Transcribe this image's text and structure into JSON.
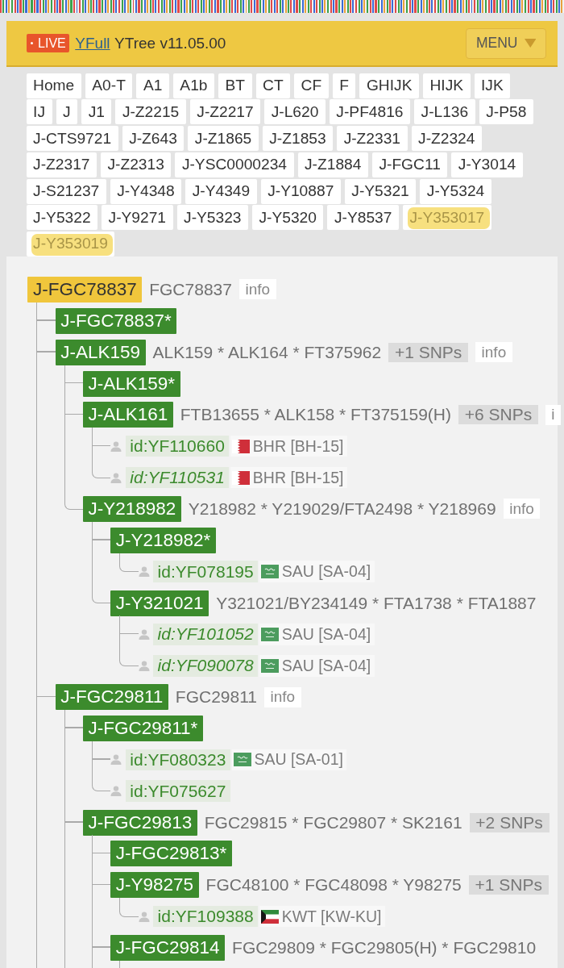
{
  "header": {
    "live_badge": "LIVE",
    "site_link": "YFull",
    "title": "YTree v11.05.00",
    "menu_button": "MENU"
  },
  "breadcrumbs": [
    {
      "label": "Home",
      "highlighted": false
    },
    {
      "label": "A0-T",
      "highlighted": false
    },
    {
      "label": "A1",
      "highlighted": false
    },
    {
      "label": "A1b",
      "highlighted": false
    },
    {
      "label": "BT",
      "highlighted": false
    },
    {
      "label": "CT",
      "highlighted": false
    },
    {
      "label": "CF",
      "highlighted": false
    },
    {
      "label": "F",
      "highlighted": false
    },
    {
      "label": "GHIJK",
      "highlighted": false
    },
    {
      "label": "HIJK",
      "highlighted": false
    },
    {
      "label": "IJK",
      "highlighted": false
    },
    {
      "label": "IJ",
      "highlighted": false
    },
    {
      "label": "J",
      "highlighted": false
    },
    {
      "label": "J1",
      "highlighted": false
    },
    {
      "label": "J-Z2215",
      "highlighted": false
    },
    {
      "label": "J-Z2217",
      "highlighted": false
    },
    {
      "label": "J-L620",
      "highlighted": false
    },
    {
      "label": "J-PF4816",
      "highlighted": false
    },
    {
      "label": "J-L136",
      "highlighted": false
    },
    {
      "label": "J-P58",
      "highlighted": false
    },
    {
      "label": "J-CTS9721",
      "highlighted": false
    },
    {
      "label": "J-Z643",
      "highlighted": false
    },
    {
      "label": "J-Z1865",
      "highlighted": false
    },
    {
      "label": "J-Z1853",
      "highlighted": false
    },
    {
      "label": "J-Z2331",
      "highlighted": false
    },
    {
      "label": "J-Z2324",
      "highlighted": false
    },
    {
      "label": "J-Z2317",
      "highlighted": false
    },
    {
      "label": "J-Z2313",
      "highlighted": false
    },
    {
      "label": "J-YSC0000234",
      "highlighted": false
    },
    {
      "label": "J-Z1884",
      "highlighted": false
    },
    {
      "label": "J-FGC11",
      "highlighted": false
    },
    {
      "label": "J-Y3014",
      "highlighted": false
    },
    {
      "label": "J-S21237",
      "highlighted": false
    },
    {
      "label": "J-Y4348",
      "highlighted": false
    },
    {
      "label": "J-Y4349",
      "highlighted": false
    },
    {
      "label": "J-Y10887",
      "highlighted": false
    },
    {
      "label": "J-Y5321",
      "highlighted": false
    },
    {
      "label": "J-Y5324",
      "highlighted": false
    },
    {
      "label": "J-Y5322",
      "highlighted": false
    },
    {
      "label": "J-Y9271",
      "highlighted": false
    },
    {
      "label": "J-Y5323",
      "highlighted": false
    },
    {
      "label": "J-Y5320",
      "highlighted": false
    },
    {
      "label": "J-Y8537",
      "highlighted": false
    },
    {
      "label": "J-Y353017",
      "highlighted": true
    },
    {
      "label": "J-Y353019",
      "highlighted": true
    }
  ],
  "tree": {
    "kind": "clade",
    "label": "J-FGC78837",
    "current": true,
    "snps": "FGC78837",
    "info": "info",
    "continues_below": true,
    "children": [
      {
        "kind": "clade",
        "label": "J-FGC78837*",
        "current": false
      },
      {
        "kind": "clade",
        "label": "J-ALK159",
        "current": false,
        "snps": "ALK159 * ALK164 * FT375962",
        "more_snps": "+1 SNPs",
        "info": "info",
        "continues_below": false,
        "children": [
          {
            "kind": "clade",
            "label": "J-ALK159*",
            "current": false
          },
          {
            "kind": "clade",
            "label": "J-ALK161",
            "current": false,
            "snps": "FTB13655 * ALK158 * FT375159(H)",
            "more_snps": "+6 SNPs",
            "info": "i",
            "continues_below": false,
            "children": [
              {
                "kind": "sample",
                "id": "id:YF110660",
                "italic": false,
                "flag": {
                  "kind": "bahrain"
                },
                "country": "BHR [BH-15]"
              },
              {
                "kind": "sample",
                "id": "id:YF110531",
                "italic": true,
                "flag": {
                  "kind": "bahrain"
                },
                "country": "BHR [BH-15]"
              }
            ]
          },
          {
            "kind": "clade",
            "label": "J-Y218982",
            "current": false,
            "snps": "Y218982 * Y219029/FTA2498 * Y218969",
            "info": "info",
            "continues_below": false,
            "children": [
              {
                "kind": "clade",
                "label": "J-Y218982*",
                "current": false,
                "continues_below": false,
                "children": [
                  {
                    "kind": "sample",
                    "id": "id:YF078195",
                    "italic": false,
                    "flag": {
                      "kind": "saudi"
                    },
                    "country": "SAU [SA-04]"
                  }
                ]
              },
              {
                "kind": "clade",
                "label": "J-Y321021",
                "current": false,
                "snps": "Y321021/BY234149 * FTA1738 * FTA1887",
                "continues_below": false,
                "children": [
                  {
                    "kind": "sample",
                    "id": "id:YF101052",
                    "italic": true,
                    "flag": {
                      "kind": "saudi"
                    },
                    "country": "SAU [SA-04]"
                  },
                  {
                    "kind": "sample",
                    "id": "id:YF090078",
                    "italic": true,
                    "flag": {
                      "kind": "saudi"
                    },
                    "country": "SAU [SA-04]"
                  }
                ]
              }
            ]
          }
        ]
      },
      {
        "kind": "clade",
        "label": "J-FGC29811",
        "current": false,
        "snps": "FGC29811",
        "info": "info",
        "continues_below": true,
        "children": [
          {
            "kind": "clade",
            "label": "J-FGC29811*",
            "current": false,
            "continues_below": false,
            "children": [
              {
                "kind": "sample",
                "id": "id:YF080323",
                "italic": false,
                "flag": {
                  "kind": "saudi"
                },
                "country": "SAU [SA-01]"
              },
              {
                "kind": "sample",
                "id": "id:YF075627",
                "italic": false
              }
            ]
          },
          {
            "kind": "clade",
            "label": "J-FGC29813",
            "current": false,
            "snps": "FGC29815 * FGC29807 * SK2161",
            "more_snps": "+2 SNPs",
            "continues_below": true,
            "children": [
              {
                "kind": "clade",
                "label": "J-FGC29813*",
                "current": false
              },
              {
                "kind": "clade",
                "label": "J-Y98275",
                "current": false,
                "snps": "FGC48100 * FGC48098 * Y98275",
                "more_snps": "+1 SNPs",
                "continues_below": false,
                "children": [
                  {
                    "kind": "sample",
                    "id": "id:YF109388",
                    "italic": false,
                    "flag": {
                      "kind": "kuwait"
                    },
                    "country": "KWT [KW-KU]"
                  }
                ]
              },
              {
                "kind": "clade",
                "label": "J-FGC29814",
                "current": false,
                "snps": "FGC29809 * FGC29805(H) * FGC29810",
                "continues_below": true
              }
            ]
          }
        ]
      }
    ]
  }
}
